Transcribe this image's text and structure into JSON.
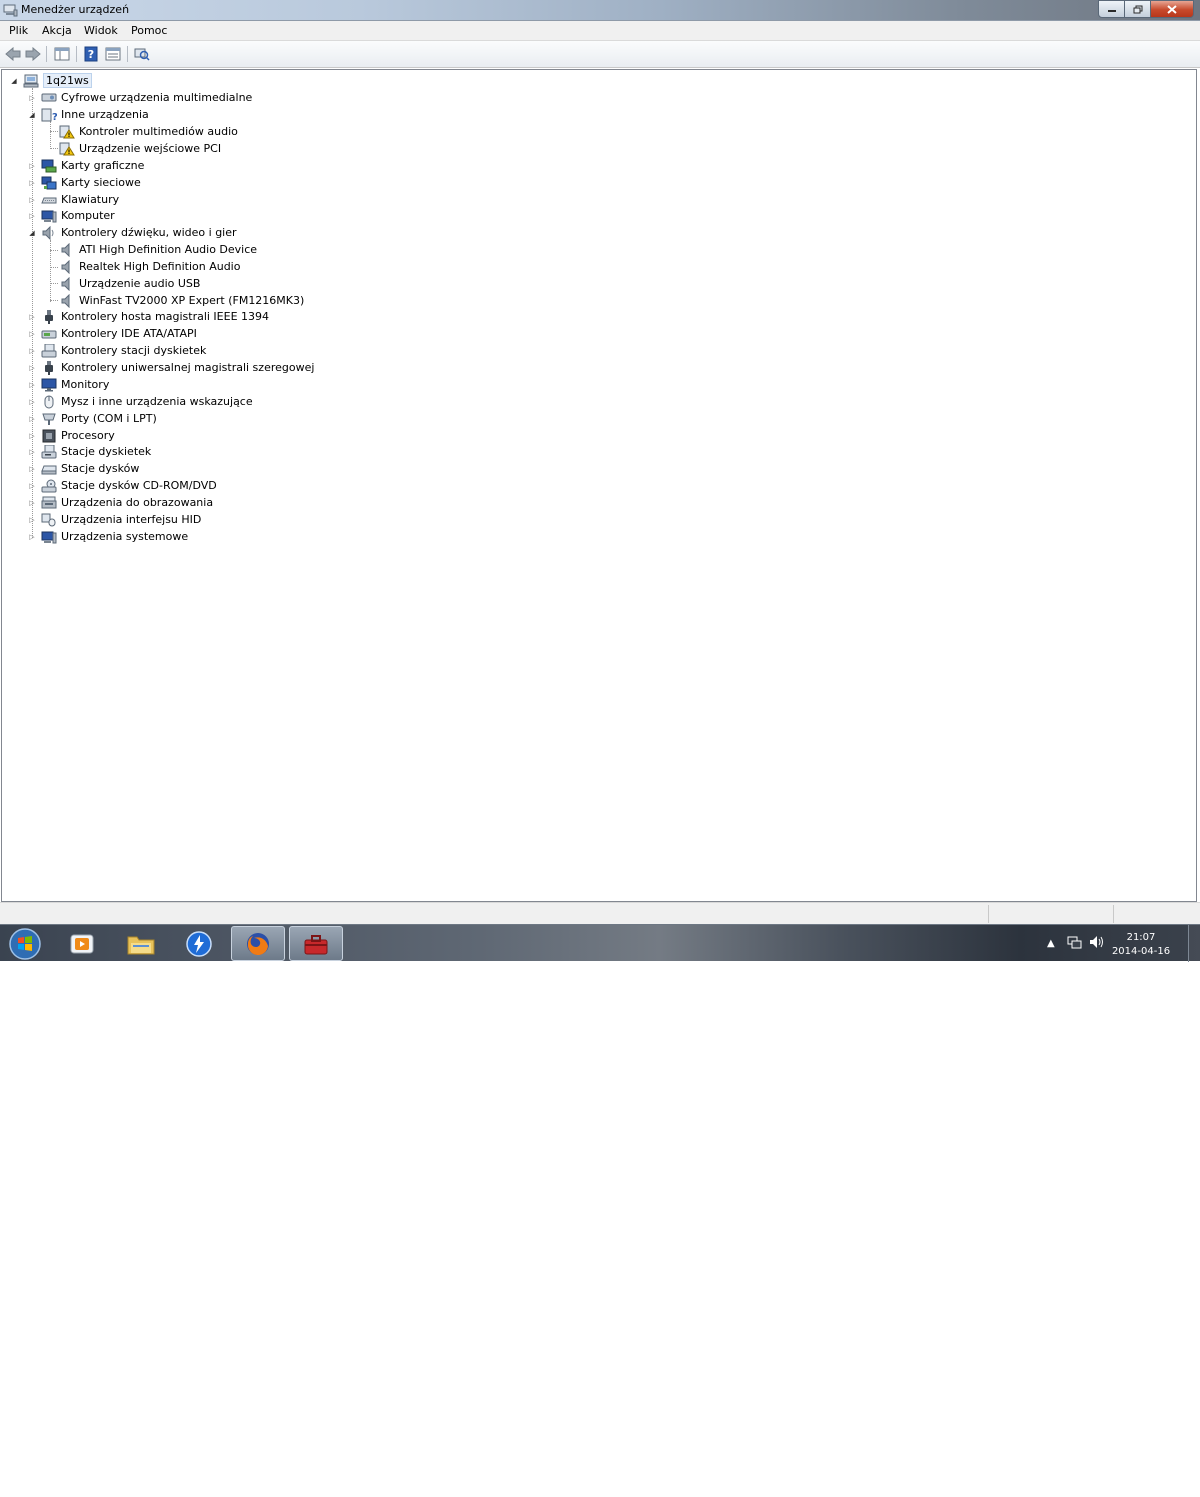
{
  "window": {
    "title": "Menedżer urządzeń"
  },
  "menu": {
    "items": [
      "Plik",
      "Akcja",
      "Widok",
      "Pomoc"
    ]
  },
  "tree": {
    "root": "1q21ws",
    "nodes": [
      {
        "label": "Cyfrowe urządzenia multimedialne",
        "icon": "media-device-icon"
      },
      {
        "label": "Inne urządzenia",
        "icon": "other-devices-icon"
      },
      {
        "label": "Kontroler multimediów audio",
        "icon": "warning-device-icon"
      },
      {
        "label": "Urządzenie wejściowe PCI",
        "icon": "warning-device-icon"
      },
      {
        "label": "Karty graficzne",
        "icon": "display-adapter-icon"
      },
      {
        "label": "Karty sieciowe",
        "icon": "network-adapter-icon"
      },
      {
        "label": "Klawiatury",
        "icon": "keyboard-icon"
      },
      {
        "label": "Komputer",
        "icon": "computer-icon"
      },
      {
        "label": "Kontrolery dźwięku, wideo i gier",
        "icon": "speaker-icon"
      },
      {
        "label": "ATI High Definition Audio Device",
        "icon": "speaker-icon"
      },
      {
        "label": "Realtek High Definition Audio",
        "icon": "speaker-icon"
      },
      {
        "label": "Urządzenie audio USB",
        "icon": "speaker-icon"
      },
      {
        "label": "WinFast TV2000 XP Expert (FM1216MK3)",
        "icon": "speaker-icon"
      },
      {
        "label": "Kontrolery hosta magistrali IEEE 1394",
        "icon": "firewire-icon"
      },
      {
        "label": "Kontrolery IDE ATA/ATAPI",
        "icon": "ide-controller-icon"
      },
      {
        "label": "Kontrolery stacji dyskietek",
        "icon": "floppy-controller-icon"
      },
      {
        "label": "Kontrolery uniwersalnej magistrali szeregowej",
        "icon": "usb-icon"
      },
      {
        "label": "Monitory",
        "icon": "monitor-icon"
      },
      {
        "label": "Mysz i inne urządzenia wskazujące",
        "icon": "mouse-icon"
      },
      {
        "label": "Porty (COM i LPT)",
        "icon": "port-icon"
      },
      {
        "label": "Procesory",
        "icon": "processor-icon"
      },
      {
        "label": "Stacje dyskietek",
        "icon": "floppy-drive-icon"
      },
      {
        "label": "Stacje dysków",
        "icon": "disk-drive-icon"
      },
      {
        "label": "Stacje dysków CD-ROM/DVD",
        "icon": "cdrom-icon"
      },
      {
        "label": "Urządzenia do obrazowania",
        "icon": "imaging-device-icon"
      },
      {
        "label": "Urządzenia interfejsu HID",
        "icon": "hid-icon"
      },
      {
        "label": "Urządzenia systemowe",
        "icon": "system-device-icon"
      }
    ]
  },
  "taskbar": {
    "clock_time": "21:07",
    "clock_date": "2014-04-16"
  }
}
